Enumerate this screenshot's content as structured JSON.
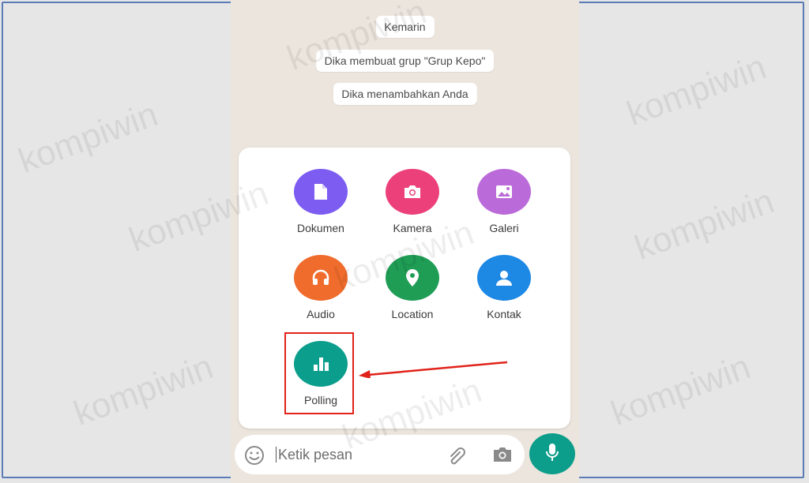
{
  "chat": {
    "date_label": "Kemarin",
    "system_messages": [
      "Dika membuat grup \"Grup Kepo\"",
      "Dika menambahkan Anda"
    ]
  },
  "attachments": {
    "items": [
      {
        "label": "Dokumen",
        "icon": "document-icon",
        "color": "#7c5cf1"
      },
      {
        "label": "Kamera",
        "icon": "camera-icon",
        "color": "#ec407a"
      },
      {
        "label": "Galeri",
        "icon": "gallery-icon",
        "color": "#bb6bd9"
      },
      {
        "label": "Audio",
        "icon": "headphones-icon",
        "color": "#ef6c2c"
      },
      {
        "label": "Location",
        "icon": "location-pin-icon",
        "color": "#1f9d55"
      },
      {
        "label": "Kontak",
        "icon": "contact-icon",
        "color": "#1e88e5"
      },
      {
        "label": "Polling",
        "icon": "poll-icon",
        "color": "#0b9e8c"
      }
    ]
  },
  "input": {
    "placeholder": "Ketik pesan"
  },
  "watermark": "kompiwin",
  "colors": {
    "highlight": "#e0221a",
    "mic_button": "#0c9e8a",
    "chat_background": "#ece5dd"
  }
}
